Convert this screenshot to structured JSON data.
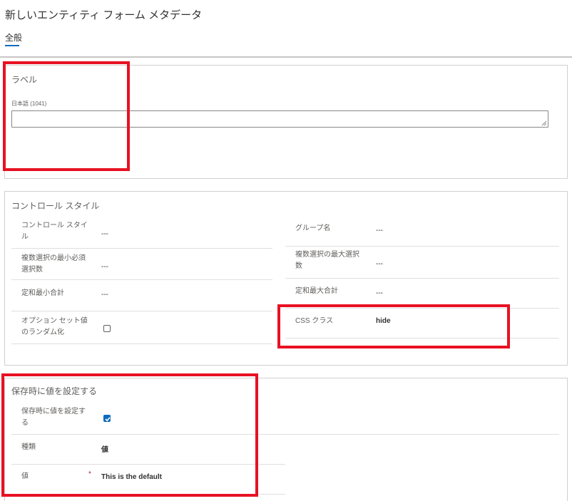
{
  "header": {
    "title": "新しいエンティティ フォーム メタデータ",
    "tab_label": "全般"
  },
  "label_section": {
    "title": "ラベル",
    "field_label": "日本語 (1041)",
    "value": ""
  },
  "control_style_section": {
    "title": "コントロール スタイル",
    "control_style_label_1": "コントロール スタイ",
    "control_style_label_2": "ル",
    "control_style_value": "---",
    "min_required_label_1": "複数選択の最小必須",
    "min_required_label_2": "選択数",
    "min_required_value": "---",
    "min_total_label": "定和最小合計",
    "min_total_value": "---",
    "randomize_label_1": "オプション セット値",
    "randomize_label_2": "のランダム化",
    "randomize_checked": false,
    "group_name_label": "グループ名",
    "group_name_value": "---",
    "max_select_label_1": "複数選択の最大選択",
    "max_select_label_2": "数",
    "max_select_value": "---",
    "max_total_label": "定和最大合計",
    "max_total_value": "---",
    "css_class_label": "CSS クラス",
    "css_class_value": "hide"
  },
  "set_value_section": {
    "title": "保存時に値を設定する",
    "set_on_save_label_1": "保存時に値を設定す",
    "set_on_save_label_2": "る",
    "set_on_save_checked": true,
    "type_label": "種類",
    "type_value": "値",
    "value_label": "値",
    "required_marker": "*",
    "value_value": "This is the default"
  },
  "colors": {
    "accent": "#0f6cbd",
    "highlight": "#e81123",
    "required": "#a4262c"
  }
}
